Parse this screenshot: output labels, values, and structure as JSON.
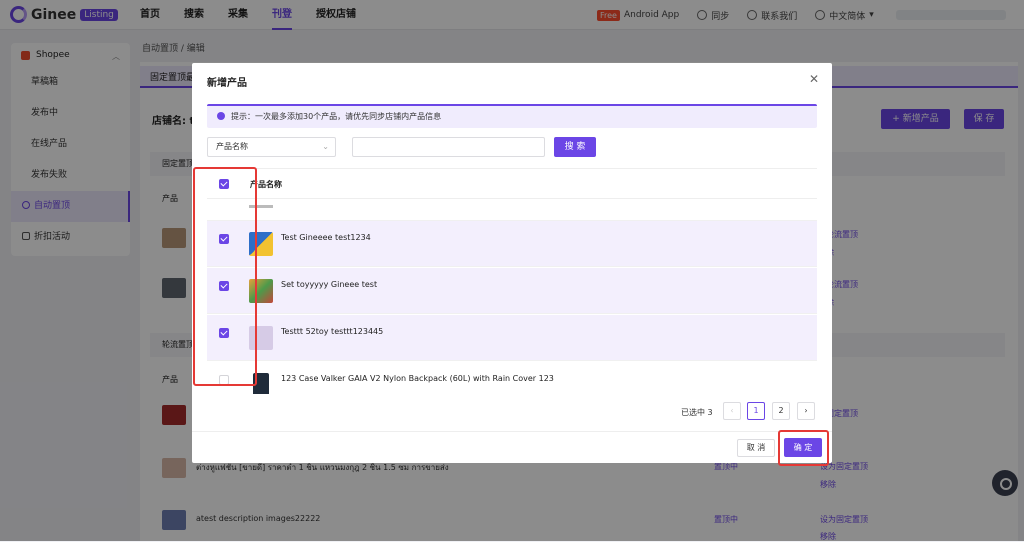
{
  "app": {
    "logo_text": "Ginee",
    "logo_badge": "Listing"
  },
  "nav": {
    "items": [
      "首页",
      "搜索",
      "采集",
      "刊登",
      "授权店铺"
    ],
    "active_index": 3
  },
  "top_right": {
    "free_badge": "Free",
    "android": "Android App",
    "sync": "同步",
    "contact": "联系我们",
    "language": "中文简体"
  },
  "sidebar": {
    "shop": "Shopee",
    "items": [
      "草稿箱",
      "发布中",
      "在线产品",
      "发布失败",
      "自动置顶",
      "折扣活动"
    ],
    "active_index": 4
  },
  "breadcrumb": "自动置顶 / 编辑",
  "background": {
    "strip_text": "固定置顶最",
    "store_label": "店铺名: te",
    "new_product_btn": "+ 新增产品",
    "save_btn": "保 存",
    "section_fixed": "固定置顶",
    "section_rotate": "轮流置顶",
    "col_product": "产品",
    "col_action": "作",
    "link_rotate": "为轮流置顶",
    "link_fixed": "为固定置顶",
    "link_fixed_full": "设为固定置顶",
    "link_remove": "移除",
    "pin_label": "置顶中",
    "row_desc": "atest description images22222",
    "row_thai": "ต่างหูแฟชั่น [ขายดี] ราคาต่ำ 1 ชิ้น แหวนมงกุฎ 2 ชิ้น 1.5 ซม การขายส่ง"
  },
  "modal": {
    "title": "新增产品",
    "tip": "提示：一次最多添加30个产品，请优先同步店铺内产品信息",
    "field_select": "产品名称",
    "search_btn": "搜 索",
    "col_name": "产品名称",
    "rows": [
      {
        "name": "Test Gineeee test1234",
        "checked": true
      },
      {
        "name": "Set toyyyyy Gineee test",
        "checked": true
      },
      {
        "name": "Testtt 52toy testtt123445",
        "checked": true
      },
      {
        "name": "123 Case Valker GAIA V2 Nylon Backpack (60L) with Rain Cover 123",
        "checked": false
      }
    ],
    "selected_count": "已选中 3",
    "pages": [
      "1",
      "2"
    ],
    "current_page": 1,
    "cancel": "取 消",
    "confirm": "确 定"
  },
  "colors": {
    "accent": "#6b46e6",
    "highlight": "#e53935"
  }
}
